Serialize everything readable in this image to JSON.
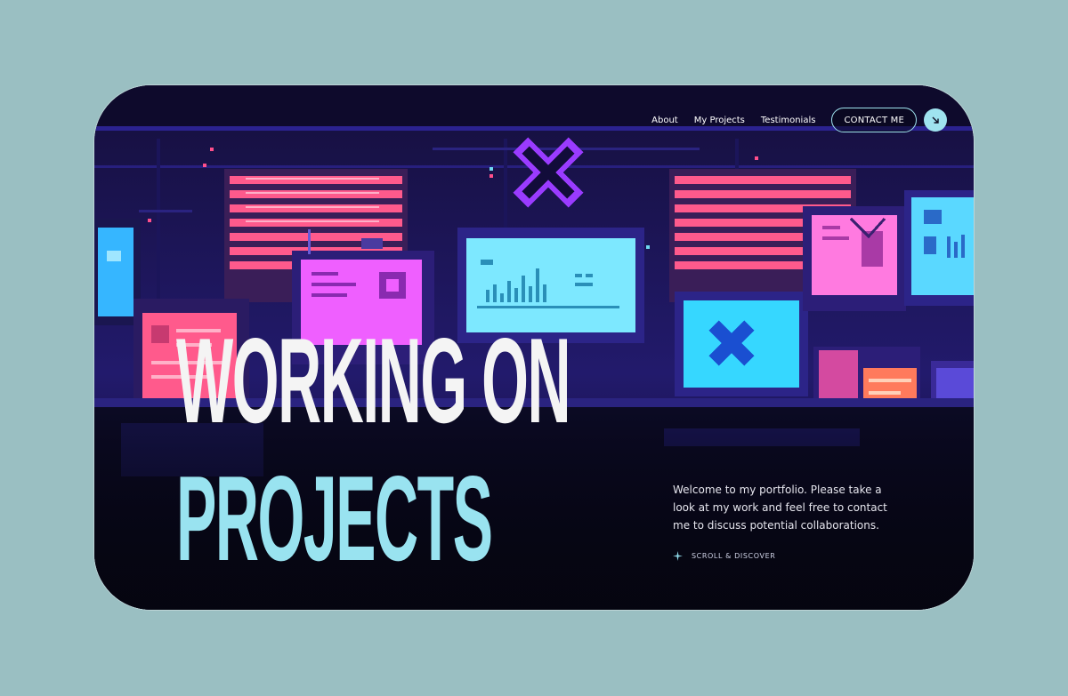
{
  "nav": {
    "links": [
      "About",
      "My Projects",
      "Testimonials"
    ],
    "contact_label": "CONTACT ME",
    "arrow_icon": "arrow-down-right-icon"
  },
  "hero": {
    "line1": "WORKING ON",
    "line2": "PROJECTS"
  },
  "intro": {
    "text": "Welcome to my portfolio. Please take a look at my work and feel free to contact me to discuss potential collaborations."
  },
  "scroll": {
    "label": "SCROLL & DISCOVER",
    "icon": "sparkle-icon"
  },
  "colors": {
    "page_background": "#9abfc2",
    "accent": "#9fe3ef",
    "neon_pink": "#ff5a8c",
    "neon_purple": "#9a3bff"
  }
}
